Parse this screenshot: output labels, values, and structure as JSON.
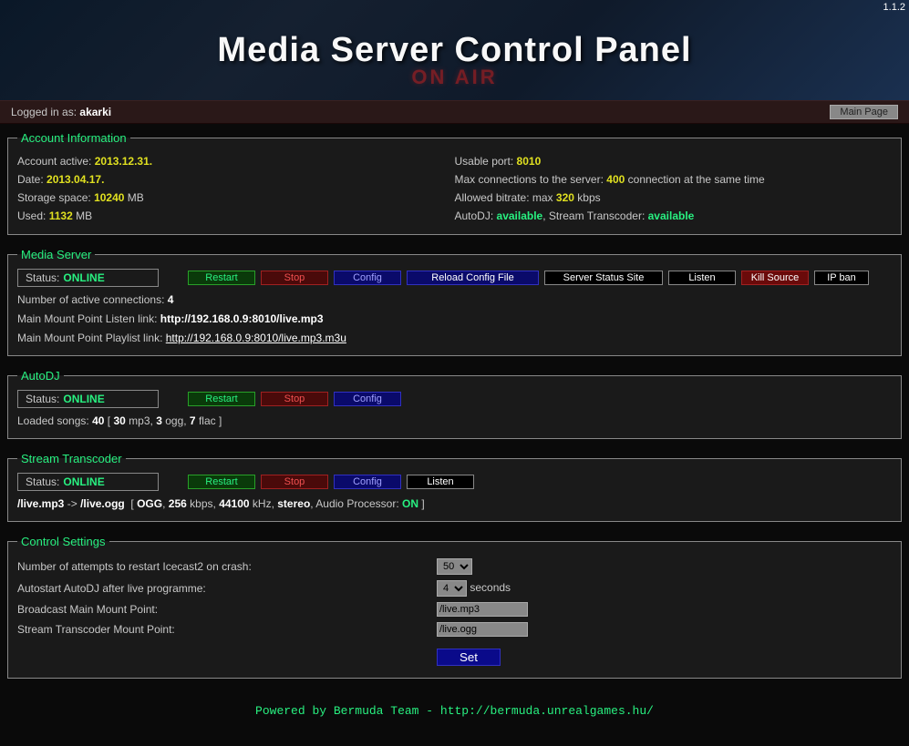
{
  "version": "1.1.2",
  "header": {
    "title": "Media Server Control Panel",
    "onair": "ON AIR"
  },
  "login": {
    "prefix": "Logged in as:",
    "user": "akarki",
    "mainpage_btn": "Main Page"
  },
  "account": {
    "legend": "Account Information",
    "active_lbl": "Account active:",
    "active_val": "2013.12.31.",
    "date_lbl": "Date:",
    "date_val": "2013.04.17.",
    "storage_lbl": "Storage space:",
    "storage_val": "10240",
    "storage_unit": "MB",
    "used_lbl": "Used:",
    "used_val": "1132",
    "used_unit": "MB",
    "port_lbl": "Usable port:",
    "port_val": "8010",
    "maxconn_lbl": "Max connections to the server:",
    "maxconn_val": "400",
    "maxconn_suffix": "connection at the same time",
    "bitrate_lbl": "Allowed bitrate: max",
    "bitrate_val": "320",
    "bitrate_unit": "kbps",
    "autodj_lbl": "AutoDJ:",
    "autodj_val": "available",
    "transcoder_lbl": ", Stream Transcoder:",
    "transcoder_val": "available"
  },
  "mediaserver": {
    "legend": "Media Server",
    "status_lbl": "Status:",
    "status_val": "ONLINE",
    "btn_restart": "Restart",
    "btn_stop": "Stop",
    "btn_config": "Config",
    "btn_reload": "Reload Config File",
    "btn_status_site": "Server Status Site",
    "btn_listen": "Listen",
    "btn_kill": "Kill Source",
    "btn_ipban": "IP ban",
    "conn_lbl": "Number of active connections:",
    "conn_val": "4",
    "listen_lbl": "Main Mount Point Listen link:",
    "listen_url": "http://192.168.0.9:8010/live.mp3",
    "playlist_lbl": "Main Mount Point Playlist link:",
    "playlist_url": "http://192.168.0.9:8010/live.mp3.m3u"
  },
  "autodj": {
    "legend": "AutoDJ",
    "status_lbl": "Status:",
    "status_val": "ONLINE",
    "btn_restart": "Restart",
    "btn_stop": "Stop",
    "btn_config": "Config",
    "songs_lbl": "Loaded songs:",
    "songs_val": "40",
    "mp3_val": "30",
    "mp3_lbl": "mp3,",
    "ogg_val": "3",
    "ogg_lbl": "ogg,",
    "flac_val": "7",
    "flac_lbl": "flac"
  },
  "transcoder": {
    "legend": "Stream Transcoder",
    "status_lbl": "Status:",
    "status_val": "ONLINE",
    "btn_restart": "Restart",
    "btn_stop": "Stop",
    "btn_config": "Config",
    "btn_listen": "Listen",
    "route_src": "/live.mp3",
    "route_arrow": "->",
    "route_dst": "/live.ogg",
    "fmt_codec": "OGG",
    "fmt_bitrate": "256",
    "fmt_bitrate_unit": "kbps,",
    "fmt_rate": "44100",
    "fmt_rate_unit": "kHz,",
    "fmt_channels": "stereo",
    "fmt_proc_lbl": ", Audio Processor:",
    "fmt_proc_val": "ON"
  },
  "settings": {
    "legend": "Control Settings",
    "restart_lbl": "Number of attempts to restart Icecast2 on crash:",
    "restart_val": "50",
    "autostart_lbl": "Autostart AutoDJ after live programme:",
    "autostart_val": "4",
    "autostart_unit": "seconds",
    "bcast_lbl": "Broadcast Main Mount Point:",
    "bcast_val": "/live.mp3",
    "trans_lbl": "Stream Transcoder Mount Point:",
    "trans_val": "/live.ogg",
    "set_btn": "Set"
  },
  "footer": {
    "prefix": "Powered by Bermuda Team -",
    "url": "http://bermuda.unrealgames.hu/"
  }
}
